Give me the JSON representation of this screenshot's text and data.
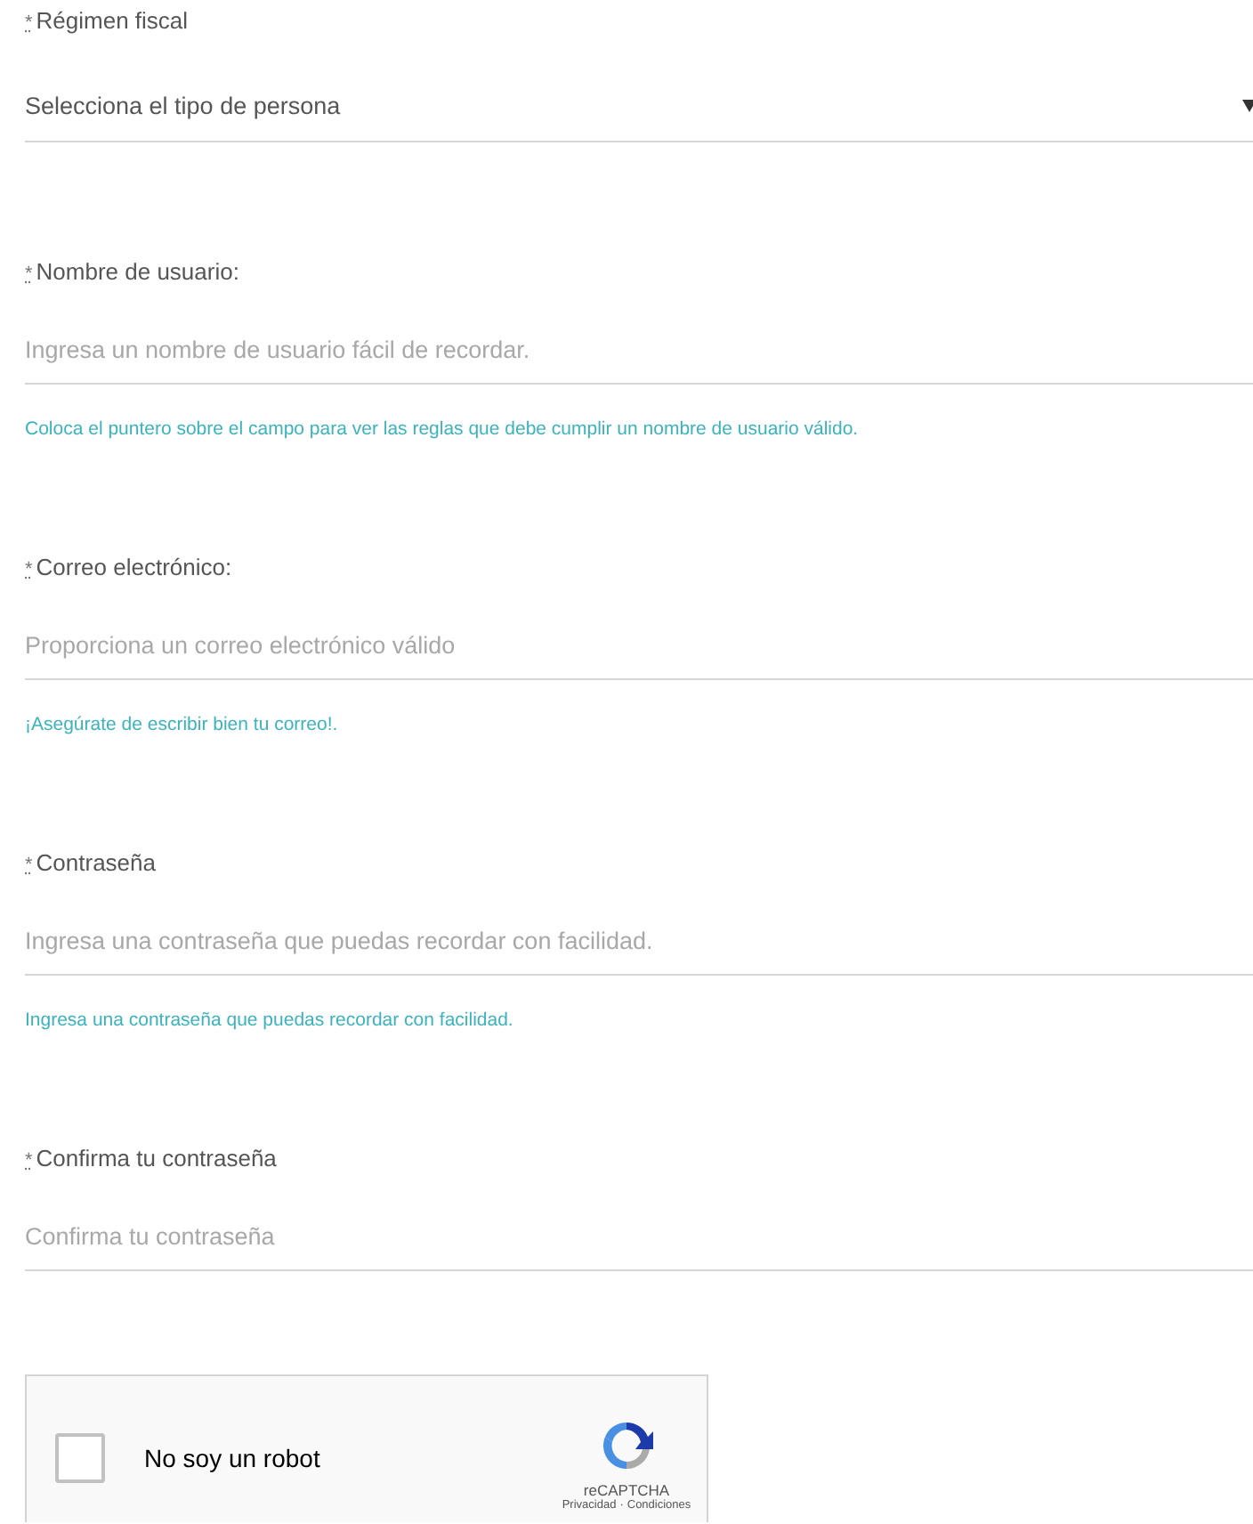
{
  "fields": [
    {
      "kind": "select",
      "required_mark": "*",
      "label": "Régimen fiscal",
      "value": "Selecciona el tipo de persona"
    },
    {
      "kind": "input",
      "required_mark": "*",
      "label": "Nombre de usuario:",
      "placeholder": "Ingresa un nombre de usuario fácil de recordar.",
      "hint": "Coloca el puntero sobre el campo para ver las reglas que debe cumplir un nombre de usuario válido."
    },
    {
      "kind": "input",
      "required_mark": "*",
      "label": "Correo electrónico:",
      "placeholder": "Proporciona un correo electrónico válido",
      "hint": "¡Asegúrate de escribir bien tu correo!."
    },
    {
      "kind": "input",
      "required_mark": "*",
      "label": "Contraseña",
      "placeholder": "Ingresa una contraseña que puedas recordar con facilidad.",
      "hint": "Ingresa una contraseña que puedas recordar con facilidad."
    },
    {
      "kind": "input",
      "required_mark": "*",
      "label": "Confirma tu contraseña",
      "placeholder": "Confirma tu contraseña"
    }
  ],
  "captcha": {
    "checked": false,
    "label": "No soy un robot",
    "brand": "reCAPTCHA",
    "privacy": "Privacidad",
    "separator": "·",
    "terms": "Condiciones"
  }
}
